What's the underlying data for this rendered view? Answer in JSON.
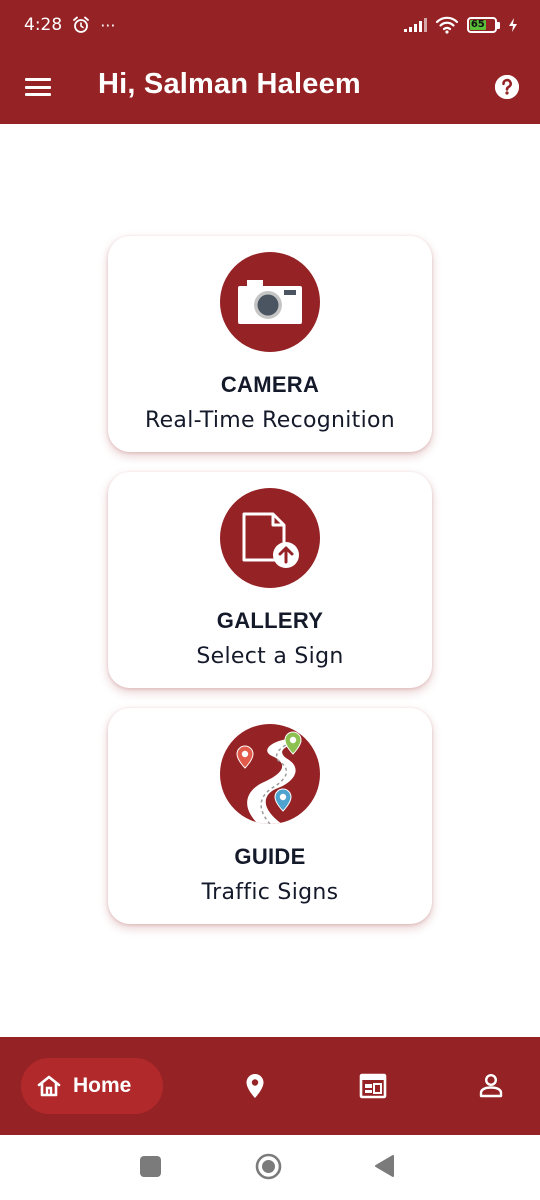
{
  "status_bar": {
    "time": "4:28",
    "more_indicator": "···",
    "battery_level": "65",
    "icons": [
      "alarm-icon",
      "signal-icon",
      "wifi-icon",
      "battery-icon",
      "charging-icon"
    ]
  },
  "app_bar": {
    "greeting": "Hi, Salman Haleem",
    "menu_icon": "hamburger-menu-icon",
    "help_icon": "help-icon"
  },
  "cards": [
    {
      "title": "CAMERA",
      "subtitle": "Real-Time Recognition",
      "icon": "camera-icon"
    },
    {
      "title": "GALLERY",
      "subtitle": "Select a Sign",
      "icon": "file-upload-icon"
    },
    {
      "title": "GUIDE",
      "subtitle": "Traffic Signs",
      "icon": "road-map-icon"
    }
  ],
  "bottom_nav": {
    "items": [
      {
        "label": "Home",
        "icon": "home-icon",
        "active": true
      },
      {
        "label": "",
        "icon": "location-pin-icon",
        "active": false
      },
      {
        "label": "",
        "icon": "calendar-icon",
        "active": false
      },
      {
        "label": "",
        "icon": "profile-icon",
        "active": false
      }
    ]
  },
  "colors": {
    "brand": "#952224",
    "active_pill": "#b2292b",
    "text_dark": "#151a2b",
    "battery_green": "#5bbf3a"
  }
}
